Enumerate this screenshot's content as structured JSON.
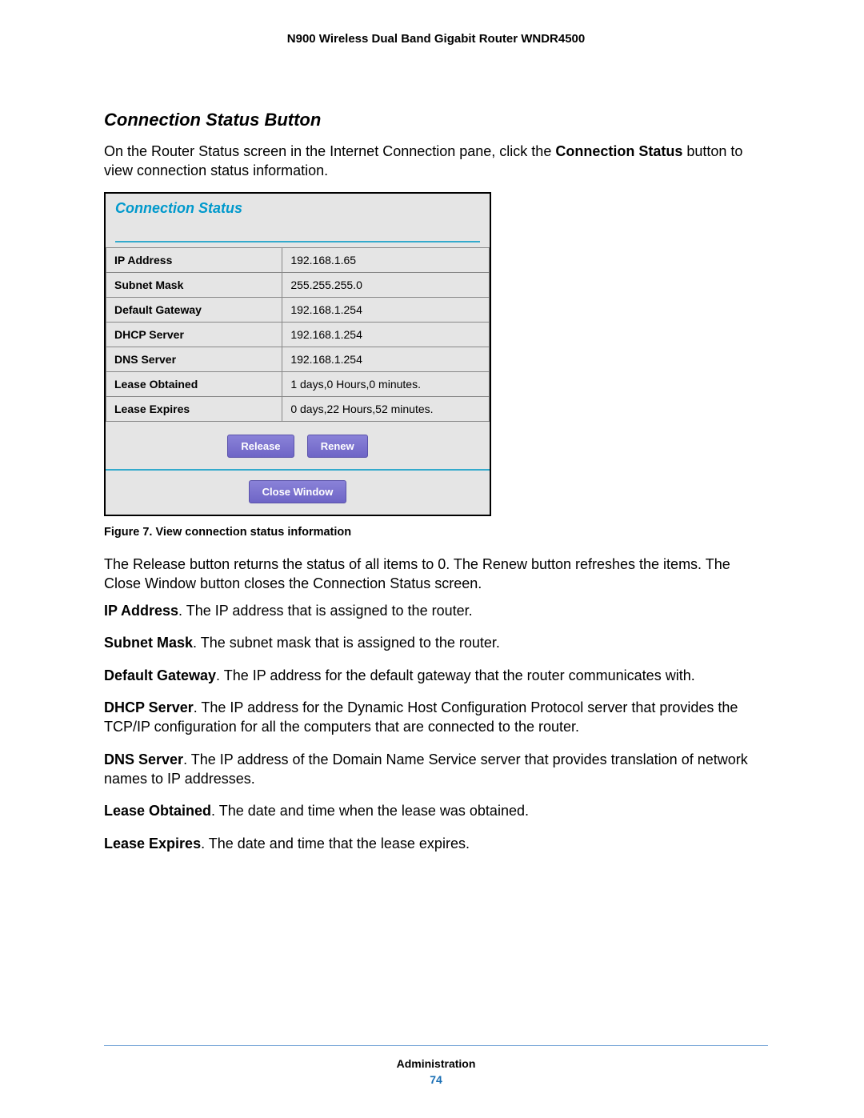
{
  "docTitle": "N900 Wireless Dual Band Gigabit Router WNDR4500",
  "sectionHeading": "Connection Status Button",
  "intro": {
    "pre": "On the Router Status screen in the Internet Connection pane, click the ",
    "bold": "Connection Status",
    "post": " button to view connection status information."
  },
  "screenshot": {
    "title": "Connection Status",
    "rows": [
      {
        "label": "IP Address",
        "value": "192.168.1.65"
      },
      {
        "label": "Subnet Mask",
        "value": "255.255.255.0"
      },
      {
        "label": "Default Gateway",
        "value": "192.168.1.254"
      },
      {
        "label": "DHCP Server",
        "value": "192.168.1.254"
      },
      {
        "label": "DNS Server",
        "value": "192.168.1.254"
      },
      {
        "label": "Lease Obtained",
        "value": "1 days,0 Hours,0 minutes."
      },
      {
        "label": "Lease Expires",
        "value": "0 days,22 Hours,52 minutes."
      }
    ],
    "buttons": {
      "release": "Release",
      "renew": "Renew",
      "close": "Close Window"
    }
  },
  "figureCaption": "Figure 7. View connection status information",
  "postFigure": "The Release button returns the status of all items to 0. The Renew button refreshes the items. The Close Window button closes the Connection Status screen.",
  "definitions": [
    {
      "term": "IP Address",
      "desc": ". The IP address that is assigned to the router."
    },
    {
      "term": "Subnet Mask",
      "desc": ". The subnet mask that is assigned to the router."
    },
    {
      "term": "Default Gateway",
      "desc": ". The IP address for the default gateway that the router communicates with."
    },
    {
      "term": "DHCP Server",
      "desc": ". The IP address for the Dynamic Host Configuration Protocol server that provides the TCP/IP configuration for all the computers that are connected to the router."
    },
    {
      "term": "DNS Server",
      "desc": ". The IP address of the Domain Name Service server that provides translation of network names to IP addresses."
    },
    {
      "term": "Lease Obtained",
      "desc": ". The date and time when the lease was obtained."
    },
    {
      "term": "Lease Expires",
      "desc": ". The date and time that the lease expires."
    }
  ],
  "footer": {
    "chapter": "Administration",
    "page": "74"
  }
}
